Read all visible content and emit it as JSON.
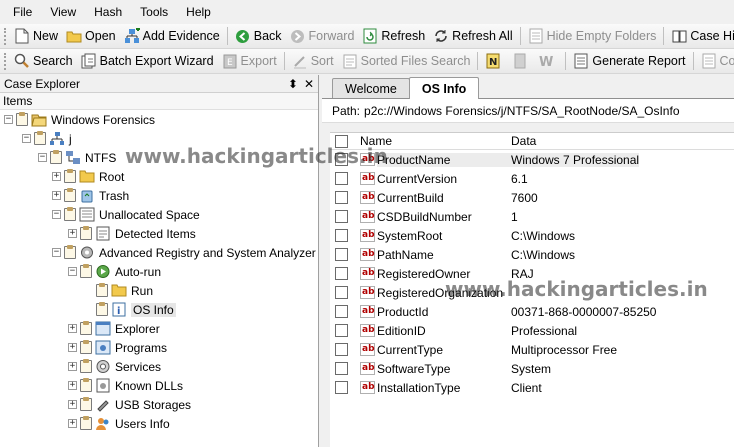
{
  "menu": [
    "File",
    "View",
    "Hash",
    "Tools",
    "Help"
  ],
  "toolbar1": {
    "new": "New",
    "open": "Open",
    "add_evidence": "Add Evidence",
    "back": "Back",
    "forward": "Forward",
    "refresh": "Refresh",
    "refresh_all": "Refresh All",
    "hide_empty": "Hide Empty Folders",
    "case_history": "Case History"
  },
  "toolbar2": {
    "search": "Search",
    "batch_export": "Batch Export Wizard",
    "export": "Export",
    "sort": "Sort",
    "sorted_search": "Sorted Files Search",
    "generate_report": "Generate Report",
    "count": "Count Co"
  },
  "case_explorer": {
    "title": "Case Explorer",
    "pin": "⬍",
    "close": "✕",
    "items_header": "Items"
  },
  "tree": [
    {
      "label": "Windows Forensics",
      "icon": "case-icon",
      "expander": "-"
    },
    {
      "label": "j",
      "icon": "network-icon",
      "expander": "-"
    },
    {
      "label": "NTFS",
      "icon": "ntfs-icon",
      "expander": "-"
    },
    {
      "label": "Root",
      "icon": "folder-icon",
      "expander": "+"
    },
    {
      "label": "Trash",
      "icon": "recycle-icon",
      "expander": "+"
    },
    {
      "label": "Unallocated Space",
      "icon": "unallocated-icon",
      "expander": "-"
    },
    {
      "label": "Detected Items",
      "icon": "detected-icon",
      "expander": "+"
    },
    {
      "label": "Advanced Registry and System Analyzer",
      "icon": "gear-icon",
      "expander": "-"
    },
    {
      "label": "Auto-run",
      "icon": "autorun-icon",
      "expander": "-"
    },
    {
      "label": "Run",
      "icon": "folder-icon",
      "expander": ""
    },
    {
      "label": "OS Info",
      "icon": "info-icon",
      "expander": ""
    },
    {
      "label": "Explorer",
      "icon": "explorer-icon",
      "expander": "+"
    },
    {
      "label": "Programs",
      "icon": "programs-icon",
      "expander": "+"
    },
    {
      "label": "Services",
      "icon": "services-icon",
      "expander": "+"
    },
    {
      "label": "Known DLLs",
      "icon": "dll-icon",
      "expander": "+"
    },
    {
      "label": "USB Storages",
      "icon": "usb-icon",
      "expander": "+"
    },
    {
      "label": "Users Info",
      "icon": "users-icon",
      "expander": "+"
    }
  ],
  "tabs": [
    "Welcome",
    "OS Info"
  ],
  "path": {
    "label": "Path:",
    "value": "p2c://Windows Forensics/j/NTFS/SA_RootNode/SA_OsInfo"
  },
  "grid": {
    "columns": [
      "Name",
      "Data"
    ],
    "rows": [
      [
        "ProductName",
        "Windows 7 Professional"
      ],
      [
        "CurrentVersion",
        "6.1"
      ],
      [
        "CurrentBuild",
        "7600"
      ],
      [
        "CSDBuildNumber",
        "1"
      ],
      [
        "SystemRoot",
        "C:\\Windows"
      ],
      [
        "PathName",
        "C:\\Windows"
      ],
      [
        "RegisteredOwner",
        "RAJ"
      ],
      [
        "RegisteredOrganization",
        ""
      ],
      [
        "ProductId",
        "00371-868-0000007-85250"
      ],
      [
        "EditionID",
        "Professional"
      ],
      [
        "CurrentType",
        "Multiprocessor Free"
      ],
      [
        "SoftwareType",
        "System"
      ],
      [
        "InstallationType",
        "Client"
      ]
    ]
  },
  "watermark": "www.hackingarticles.in"
}
